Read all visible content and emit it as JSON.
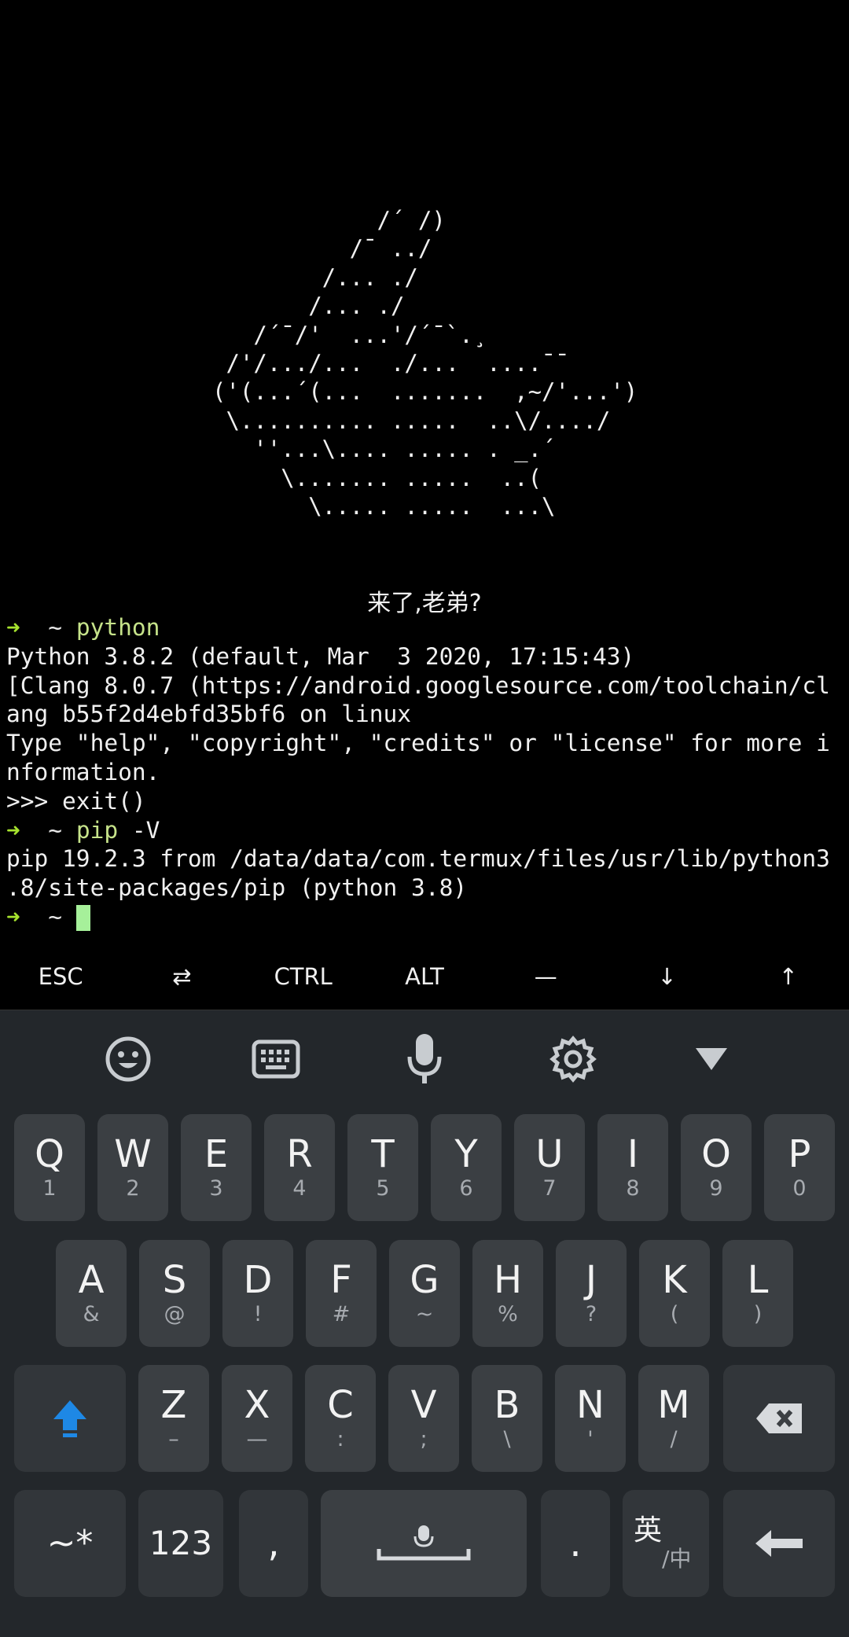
{
  "terminal": {
    "ascii_art": [
      "            /´ /)",
      "          /¯ ../",
      "        /... ./",
      "       /... ./",
      "   /´¯/'  ...'/´¯`.¸",
      " /'/.../...  ./...  ....¯¯",
      "('(...´(...  .......  ,~/'...')",
      " \\.......... .....  ..\\/..../",
      "   ''...\\.... ..... . _.´",
      "     \\....... .....  ..(",
      "       \\..... .....  ...\\"
    ],
    "greeting": "来了,老弟?",
    "lines": [
      {
        "prompt_arrow": "➜",
        "prompt_dir": "~",
        "cmd": "python",
        "args": ""
      },
      {
        "text": "Python 3.8.2 (default, Mar  3 2020, 17:15:43)"
      },
      {
        "text": "[Clang 8.0.7 (https://android.googlesource.com/toolchain/cl"
      },
      {
        "text": "ang b55f2d4ebfd35bf6 on linux"
      },
      {
        "text": "Type \"help\", \"copyright\", \"credits\" or \"license\" for more i"
      },
      {
        "text": "nformation."
      },
      {
        "text": ">>> exit()"
      },
      {
        "prompt_arrow": "➜",
        "prompt_dir": "~",
        "cmd": "pip",
        "args": " -V"
      },
      {
        "text": "pip 19.2.3 from /data/data/com.termux/files/usr/lib/python3"
      },
      {
        "text": ".8/site-packages/pip (python 3.8)"
      },
      {
        "prompt_arrow": "➜",
        "prompt_dir": "~",
        "cursor": true
      }
    ]
  },
  "extra_keys": [
    "ESC",
    "⇄",
    "CTRL",
    "ALT",
    "—",
    "↓",
    "↑"
  ],
  "keyboard": {
    "toolbar": [
      "emoji-icon",
      "keyboard-icon",
      "microphone-icon",
      "settings-icon",
      "collapse-icon"
    ],
    "row1": [
      {
        "main": "Q",
        "sub": "1"
      },
      {
        "main": "W",
        "sub": "2"
      },
      {
        "main": "E",
        "sub": "3"
      },
      {
        "main": "R",
        "sub": "4"
      },
      {
        "main": "T",
        "sub": "5"
      },
      {
        "main": "Y",
        "sub": "6"
      },
      {
        "main": "U",
        "sub": "7"
      },
      {
        "main": "I",
        "sub": "8"
      },
      {
        "main": "O",
        "sub": "9"
      },
      {
        "main": "P",
        "sub": "0"
      }
    ],
    "row2": [
      {
        "main": "A",
        "sub": "&"
      },
      {
        "main": "S",
        "sub": "@"
      },
      {
        "main": "D",
        "sub": "!"
      },
      {
        "main": "F",
        "sub": "#"
      },
      {
        "main": "G",
        "sub": "~"
      },
      {
        "main": "H",
        "sub": "%"
      },
      {
        "main": "J",
        "sub": "?"
      },
      {
        "main": "K",
        "sub": "("
      },
      {
        "main": "L",
        "sub": ")"
      }
    ],
    "row3": [
      {
        "main": "Z",
        "sub": "–"
      },
      {
        "main": "X",
        "sub": "—"
      },
      {
        "main": "C",
        "sub": ":"
      },
      {
        "main": "V",
        "sub": ";"
      },
      {
        "main": "B",
        "sub": "\\"
      },
      {
        "main": "N",
        "sub": "'"
      },
      {
        "main": "M",
        "sub": "/"
      }
    ],
    "bottom": {
      "symbols": "~*",
      "numbers": "123",
      "comma": ",",
      "period": ".",
      "lang_main": "英",
      "lang_sub": "/中"
    },
    "colors": {
      "shift_accent": "#1e88e5",
      "key_bg": "#3b3f43",
      "keyboard_bg": "#23272b",
      "prompt_arrow": "#a6e22e"
    }
  }
}
